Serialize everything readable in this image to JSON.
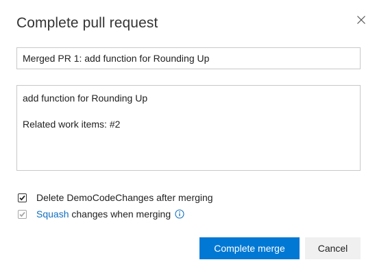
{
  "dialog": {
    "title": "Complete pull request",
    "close_icon": "close-icon"
  },
  "form": {
    "title_value": "Merged PR 1: add function for Rounding Up",
    "description_lines": [
      "add function for Rounding Up",
      "Related work items: #2"
    ]
  },
  "options": {
    "delete_branch": {
      "label": "Delete DemoCodeChanges after merging",
      "checked": true
    },
    "squash": {
      "link_text": "Squash",
      "label_rest": " changes when merging",
      "checked": true,
      "disabled": true,
      "info_icon": "info-icon"
    }
  },
  "buttons": {
    "complete_label": "Complete merge",
    "cancel_label": "Cancel"
  },
  "colors": {
    "primary": "#0078d4",
    "link": "#106ebe",
    "border": "#c8c8c8"
  }
}
